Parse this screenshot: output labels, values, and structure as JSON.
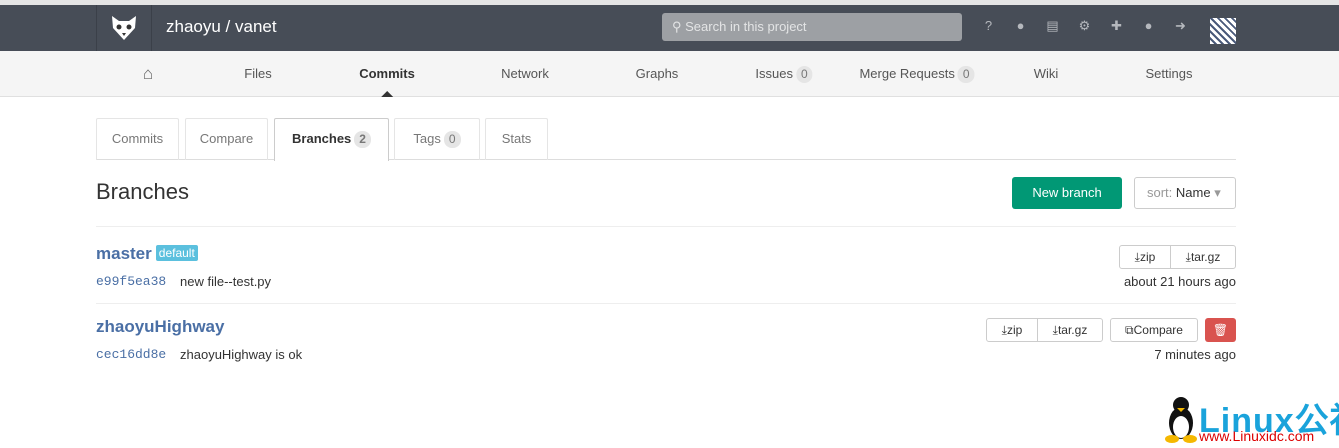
{
  "header": {
    "project": "zhaoyu / vanet",
    "search_placeholder": "Search in this project"
  },
  "nav": {
    "items": [
      {
        "label": "Files"
      },
      {
        "label": "Commits"
      },
      {
        "label": "Network"
      },
      {
        "label": "Graphs"
      },
      {
        "label": "Issues",
        "count": "0"
      },
      {
        "label": "Merge Requests",
        "count": "0"
      },
      {
        "label": "Wiki"
      },
      {
        "label": "Settings"
      }
    ]
  },
  "tabs": [
    {
      "label": "Commits"
    },
    {
      "label": "Compare"
    },
    {
      "label": "Branches",
      "count": "2"
    },
    {
      "label": "Tags",
      "count": "0"
    },
    {
      "label": "Stats"
    }
  ],
  "page": {
    "title": "Branches",
    "new_branch": "New branch",
    "sort_label": "sort:",
    "sort_value": "Name"
  },
  "branches": [
    {
      "name": "master",
      "badge": "default",
      "sha": "e99f5ea38",
      "message": "new file--test.py",
      "time": "about 21 hours ago",
      "zip": "zip",
      "targz": "tar.gz"
    },
    {
      "name": "zhaoyuHighway",
      "sha": "cec16dd8e",
      "message": "zhaoyuHighway is ok",
      "time": "7 minutes ago",
      "zip": "zip",
      "targz": "tar.gz",
      "compare": "Compare"
    }
  ],
  "watermark": {
    "logo": "Linux公社",
    "url": "www.Linuxidc.com"
  }
}
